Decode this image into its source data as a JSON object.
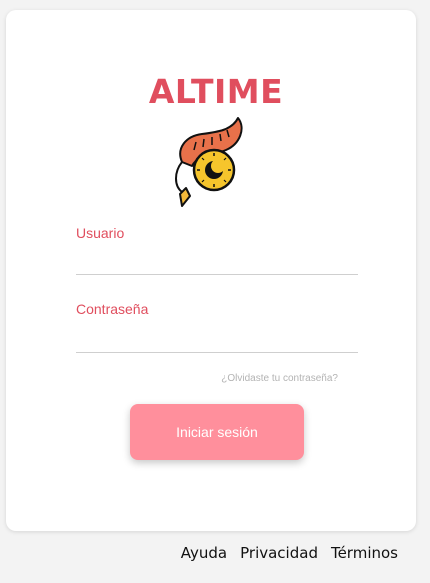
{
  "brand": {
    "name": "ALTIME"
  },
  "login": {
    "username_label": "Usuario",
    "username_value": "",
    "password_label": "Contraseña",
    "password_value": "",
    "forgot_link": "¿Olvidaste tu contraseña?",
    "submit_label": "Iniciar sesión"
  },
  "footer": {
    "links": [
      "Ayuda",
      "Privacidad",
      "Términos"
    ]
  },
  "colors": {
    "brand": "#e04e5e",
    "button": "#ff8f9c",
    "owl_orange": "#e8714a",
    "owl_yellow": "#f6c52c",
    "owl_beak": "#f4b93a"
  },
  "icons": {
    "logo": "owl-eye-clock-icon"
  }
}
